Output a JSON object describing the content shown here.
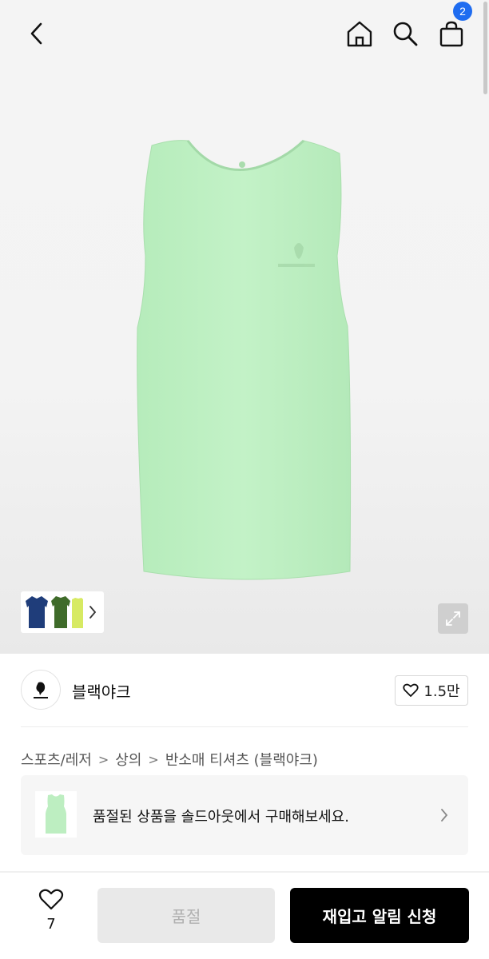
{
  "header": {
    "back_icon": "chevron-left-icon",
    "home_icon": "home-icon",
    "search_icon": "search-icon",
    "cart_icon": "shopping-bag-icon",
    "cart_count": "2"
  },
  "gallery": {
    "thumb_strip_icon": "chevron-right-icon",
    "zoom_icon": "expand-icon",
    "product_color": "#bff0c4"
  },
  "brand": {
    "name": "블랙야크",
    "likes": "1.5만",
    "like_icon": "heart-outline-icon"
  },
  "breadcrumb": [
    "스포츠/레저",
    "상의",
    "반소매 티셔츠 (블랙야크)"
  ],
  "soldout_banner": {
    "text": "품절된 상품을 솔드아웃에서 구매해보세요."
  },
  "bottom": {
    "wish_count": "7",
    "soldout_label": "품절",
    "restock_label": "재입고 알림 신청"
  },
  "colors": {
    "accent_blue": "#1e6cf0",
    "primary_button": "#000000",
    "disabled_button": "#e9e9e9"
  }
}
